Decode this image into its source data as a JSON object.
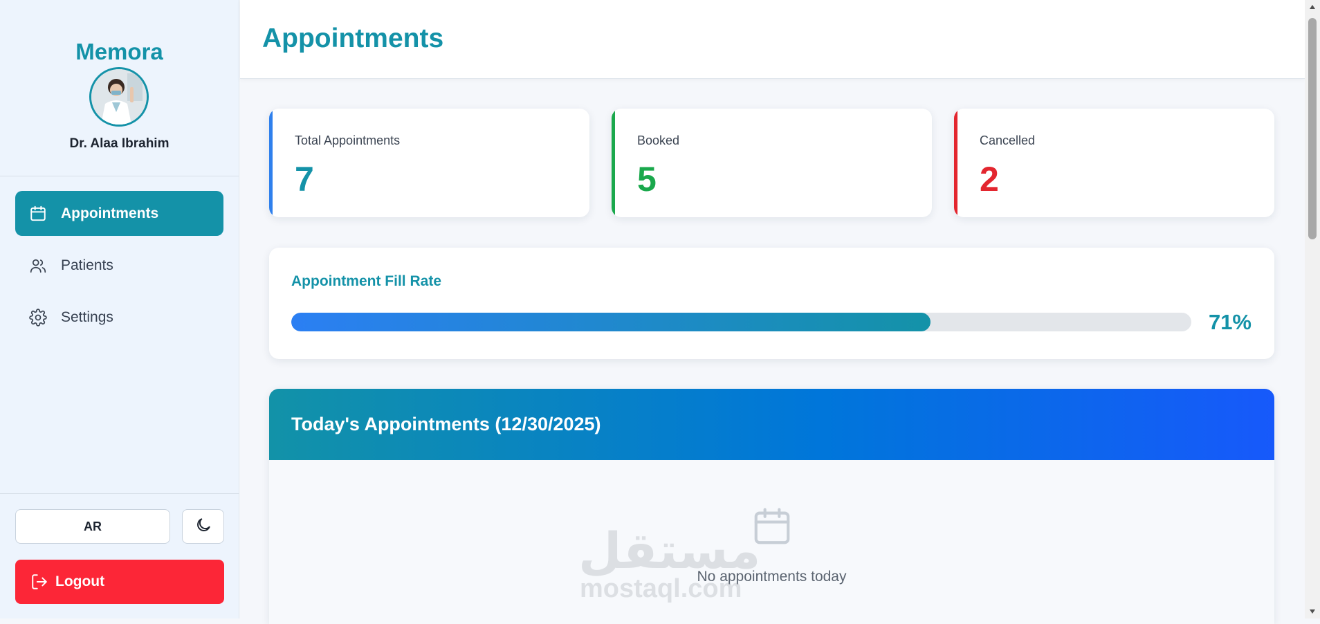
{
  "app": {
    "brand": "Memora",
    "doctor_name": "Dr. Alaa Ibrahim"
  },
  "sidebar": {
    "items": [
      {
        "label": "Appointments",
        "icon": "calendar-icon",
        "active": true
      },
      {
        "label": "Patients",
        "icon": "users-icon",
        "active": false
      },
      {
        "label": "Settings",
        "icon": "gear-icon",
        "active": false
      }
    ],
    "language_label": "AR",
    "theme_icon": "moon-icon",
    "logout_label": "Logout"
  },
  "header": {
    "title": "Appointments"
  },
  "stats": [
    {
      "label": "Total Appointments",
      "value": "7",
      "color": "#1492a8",
      "accent": "#2f80ed"
    },
    {
      "label": "Booked",
      "value": "5",
      "color": "#1aa84c",
      "accent": "#1aa84c"
    },
    {
      "label": "Cancelled",
      "value": "2",
      "color": "#e3262f",
      "accent": "#e3262f"
    }
  ],
  "fill_rate": {
    "title": "Appointment Fill Rate",
    "percent_label": "71%",
    "percent": 71
  },
  "today": {
    "title": "Today's Appointments (12/30/2025)",
    "empty_text": "No appointments today"
  },
  "watermark": {
    "arabic": "مستقل",
    "latin": "mostaql.com"
  },
  "colors": {
    "primary": "#1492a8",
    "danger": "#fc2637"
  }
}
